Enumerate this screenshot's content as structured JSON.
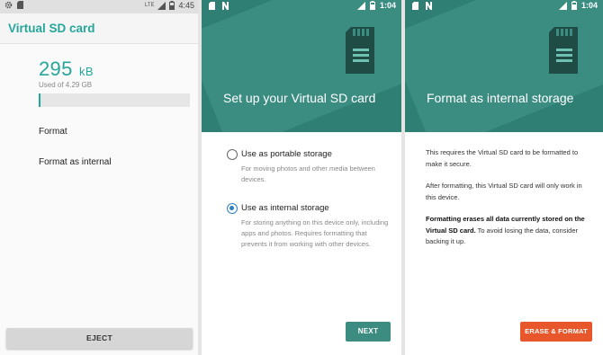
{
  "settings_screen": {
    "status_time": "4:45",
    "network_badge": "LTE",
    "title": "Virtual SD card",
    "used_amount": "295",
    "used_unit": "kB",
    "used_of": "Used of 4.29 GB",
    "usage_fraction": 0.01,
    "menu": [
      "Format",
      "Format as internal"
    ],
    "eject_label": "EJECT"
  },
  "setup_screen": {
    "status_time": "1:04",
    "title": "Set up your Virtual SD card",
    "options": [
      {
        "label": "Use as portable storage",
        "description": "For moving photos and other media between devices.",
        "selected": false
      },
      {
        "label": "Use as internal storage",
        "description": "For storing anything on this device only, including apps and photos. Requires formatting that prevents it from working with other devices.",
        "selected": true
      }
    ],
    "next_label": "NEXT"
  },
  "format_screen": {
    "status_time": "1:04",
    "title": "Format as internal storage",
    "paragraph1": "This requires the Virtual SD card to be formatted to make it secure.",
    "paragraph2": "After formatting, this Virtual SD card will only work in this device.",
    "warning_bold": "Formatting erases all data currently stored on the Virtual SD card.",
    "warning_rest": " To avoid losing the data, consider backing it up.",
    "erase_label": "ERASE & FORMAT"
  },
  "colors": {
    "accent": "#26a69a",
    "header_teal": "#2f7f75",
    "button_teal": "#3d8c82",
    "erase_orange": "#e8562b",
    "radio_blue": "#2f7fbf"
  },
  "icons": [
    "settings-gear-icon",
    "sd-card-icon",
    "battery-icon",
    "signal-icon",
    "notification-icon",
    "n-icon"
  ]
}
